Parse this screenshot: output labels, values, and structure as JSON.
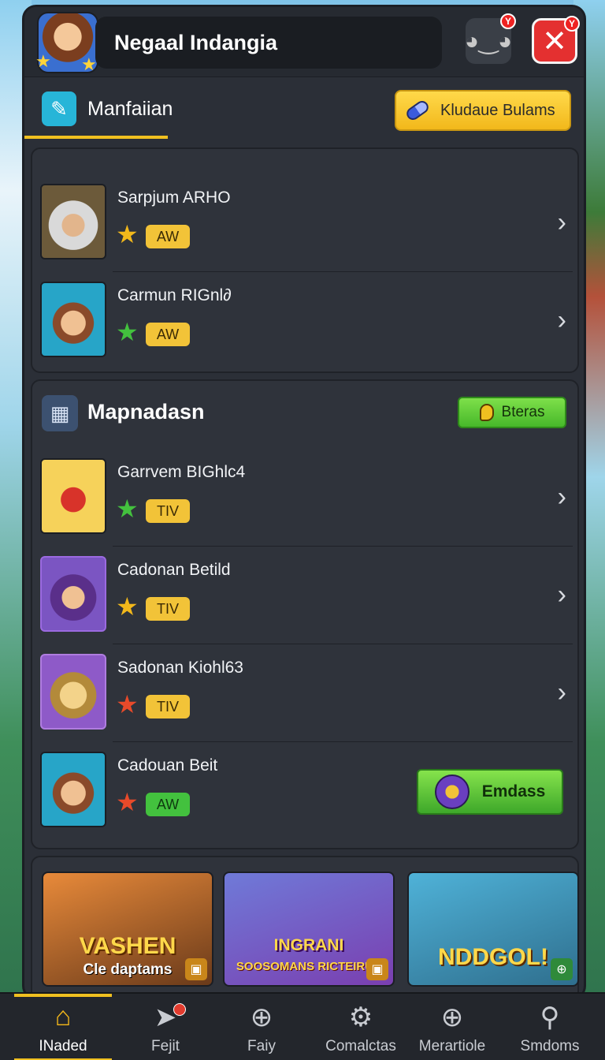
{
  "header": {
    "title": "Negaal Indangia",
    "close_glyph": "✕",
    "close_badge": "Y"
  },
  "tab": {
    "label": "Manfaiian",
    "action_label": "Kludaue Bulams"
  },
  "section1": {
    "items": [
      {
        "name": "Sarpjum ARHO",
        "tag": "AW",
        "star_color": "#f2b81b",
        "tag_color": "gold"
      },
      {
        "name": "Carmun RIGnl∂",
        "tag": "AW",
        "star_color": "#43c13e",
        "tag_color": "gold"
      }
    ]
  },
  "section2": {
    "title": "Mapnadasn",
    "action_label": "Bteras",
    "items": [
      {
        "name": "Garrvem BIGhlc4",
        "tag": "TIV",
        "star_color": "#43c13e",
        "tag_color": "gold"
      },
      {
        "name": "Cadonan Betild",
        "tag": "TIV",
        "star_color": "#f2b81b",
        "tag_color": "gold"
      },
      {
        "name": "Sadonan Kiohl63",
        "tag": "TIV",
        "star_color": "#e84a2a",
        "tag_color": "gold"
      },
      {
        "name": "Cadouan Beit",
        "tag": "AW",
        "star_color": "#e84a2a",
        "tag_color": "green"
      }
    ],
    "last_item_button": "Emdass"
  },
  "cards": [
    {
      "title": "VASHEN",
      "subtitle": "Cle daptams"
    },
    {
      "title": "INGRANI",
      "subtitle": "SOOSOMANS RICTEIRUS"
    },
    {
      "title": "NDDGOL!",
      "subtitle": ""
    }
  ],
  "bottom_nav": [
    {
      "label": "INaded",
      "icon": "home-icon",
      "active": true
    },
    {
      "label": "Fejit",
      "icon": "share-icon",
      "active": false
    },
    {
      "label": "Faiy",
      "icon": "plus-circle-icon",
      "active": false
    },
    {
      "label": "Comalctas",
      "icon": "gear-icon",
      "active": false
    },
    {
      "label": "Merartiole",
      "icon": "add-circle-icon",
      "active": false
    },
    {
      "label": "Smdoms",
      "icon": "search-icon",
      "active": false
    }
  ],
  "colors": {
    "accent_yellow": "#f0c020",
    "accent_green": "#47b82a",
    "close_red": "#e43030",
    "panel_bg": "#2b2f37"
  }
}
